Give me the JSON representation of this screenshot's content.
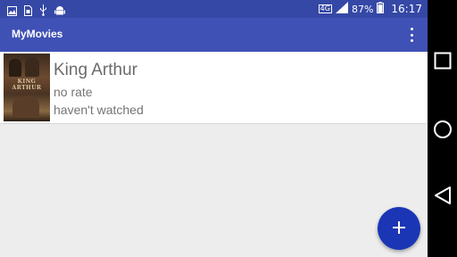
{
  "status_bar": {
    "network": "4G",
    "battery": "87%",
    "time": "16:17",
    "left_icons": [
      "image-icon",
      "sim-icon",
      "usb-icon",
      "android-debug-icon"
    ]
  },
  "app_bar": {
    "title": "MyMovies",
    "overflow_icon": "more-vert-icon"
  },
  "movies": [
    {
      "title": "King Arthur",
      "rating": "no rate",
      "watched": "haven't watched",
      "poster_text": "KING ARTHUR"
    }
  ],
  "fab": {
    "icon": "plus-icon"
  },
  "nav_bar": {
    "buttons": [
      "recents-button",
      "home-button",
      "back-button"
    ]
  },
  "colors": {
    "status_bar": "#3548a6",
    "app_bar": "#3f51b5",
    "fab": "#1b36b5",
    "background": "#ededed"
  }
}
